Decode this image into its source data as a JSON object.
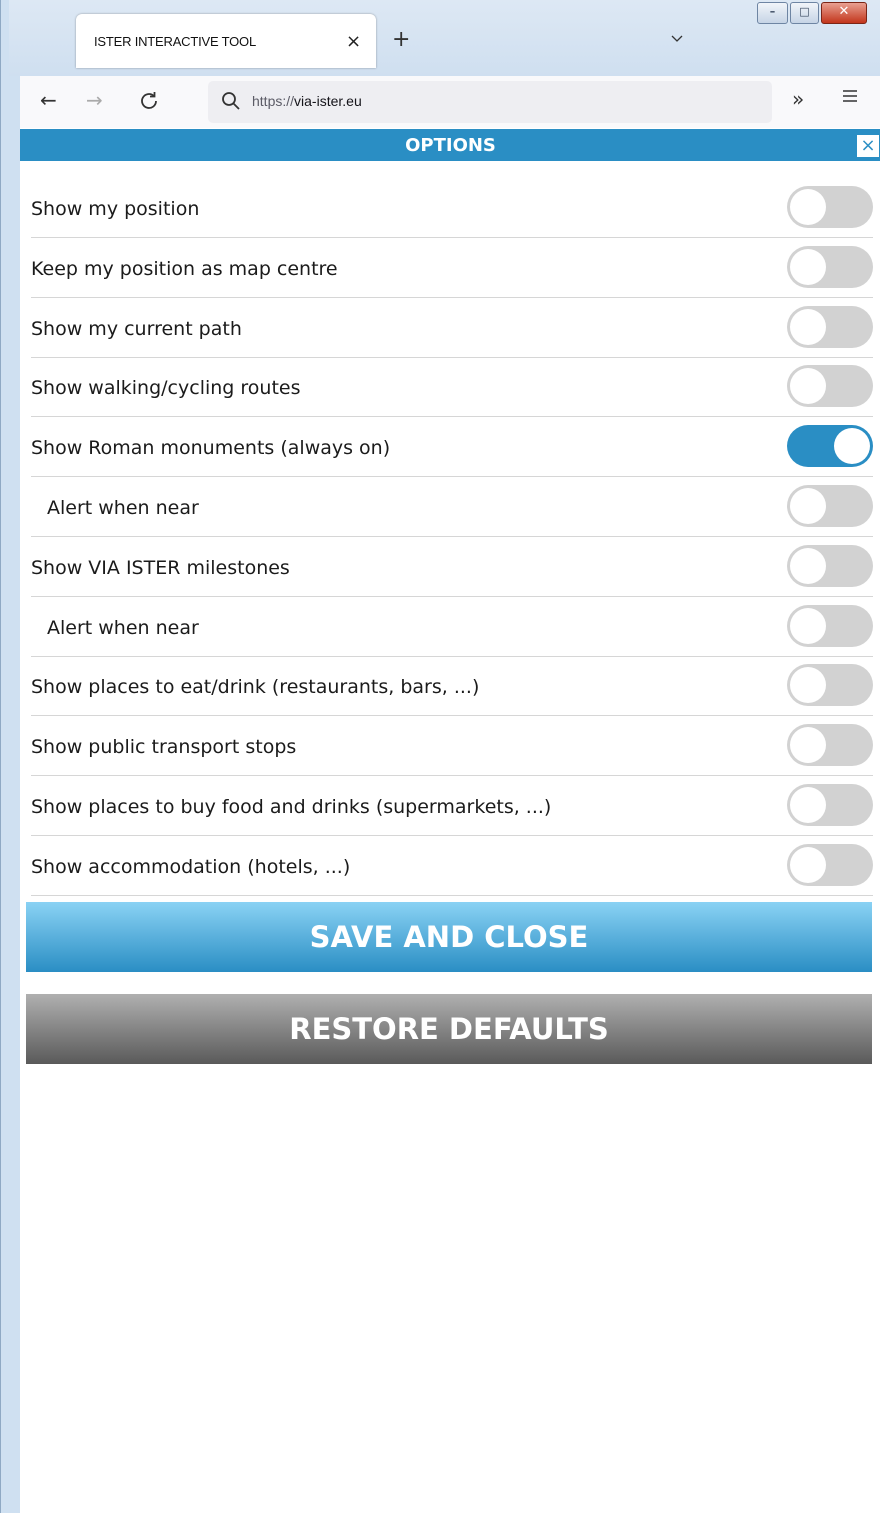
{
  "browser": {
    "tab_title": "ISTER INTERACTIVE TOOL",
    "tab_close": "×",
    "new_tab": "+",
    "url_protocol": "https://",
    "url_host": "via-ister.eu",
    "more_tools": "»"
  },
  "window_controls": {
    "minimize": "–",
    "maximize": "□",
    "close": "✕"
  },
  "panel": {
    "title": "OPTIONS",
    "close": "×",
    "options": [
      {
        "label": "Show my position",
        "indented": false,
        "enabled": false
      },
      {
        "label": "Keep my position as map centre",
        "indented": false,
        "enabled": false
      },
      {
        "label": "Show my current path",
        "indented": false,
        "enabled": false
      },
      {
        "label": "Show walking/cycling routes",
        "indented": false,
        "enabled": false
      },
      {
        "label": "Show Roman monuments (always on)",
        "indented": false,
        "enabled": true
      },
      {
        "label": "Alert when near",
        "indented": true,
        "enabled": false
      },
      {
        "label": "Show VIA ISTER milestones",
        "indented": false,
        "enabled": false
      },
      {
        "label": "Alert when near",
        "indented": true,
        "enabled": false
      },
      {
        "label": "Show places to eat/drink (restaurants, bars, ...)",
        "indented": false,
        "enabled": false
      },
      {
        "label": "Show public transport stops",
        "indented": false,
        "enabled": false
      },
      {
        "label": "Show places to buy food and drinks (supermarkets, ...)",
        "indented": false,
        "enabled": false
      },
      {
        "label": "Show accommodation (hotels, ...)",
        "indented": false,
        "enabled": false
      }
    ],
    "save_label": "SAVE AND CLOSE",
    "restore_label": "RESTORE DEFAULTS"
  },
  "colors": {
    "accent": "#2a8ec4",
    "toggle_off": "#d2d2d2"
  }
}
